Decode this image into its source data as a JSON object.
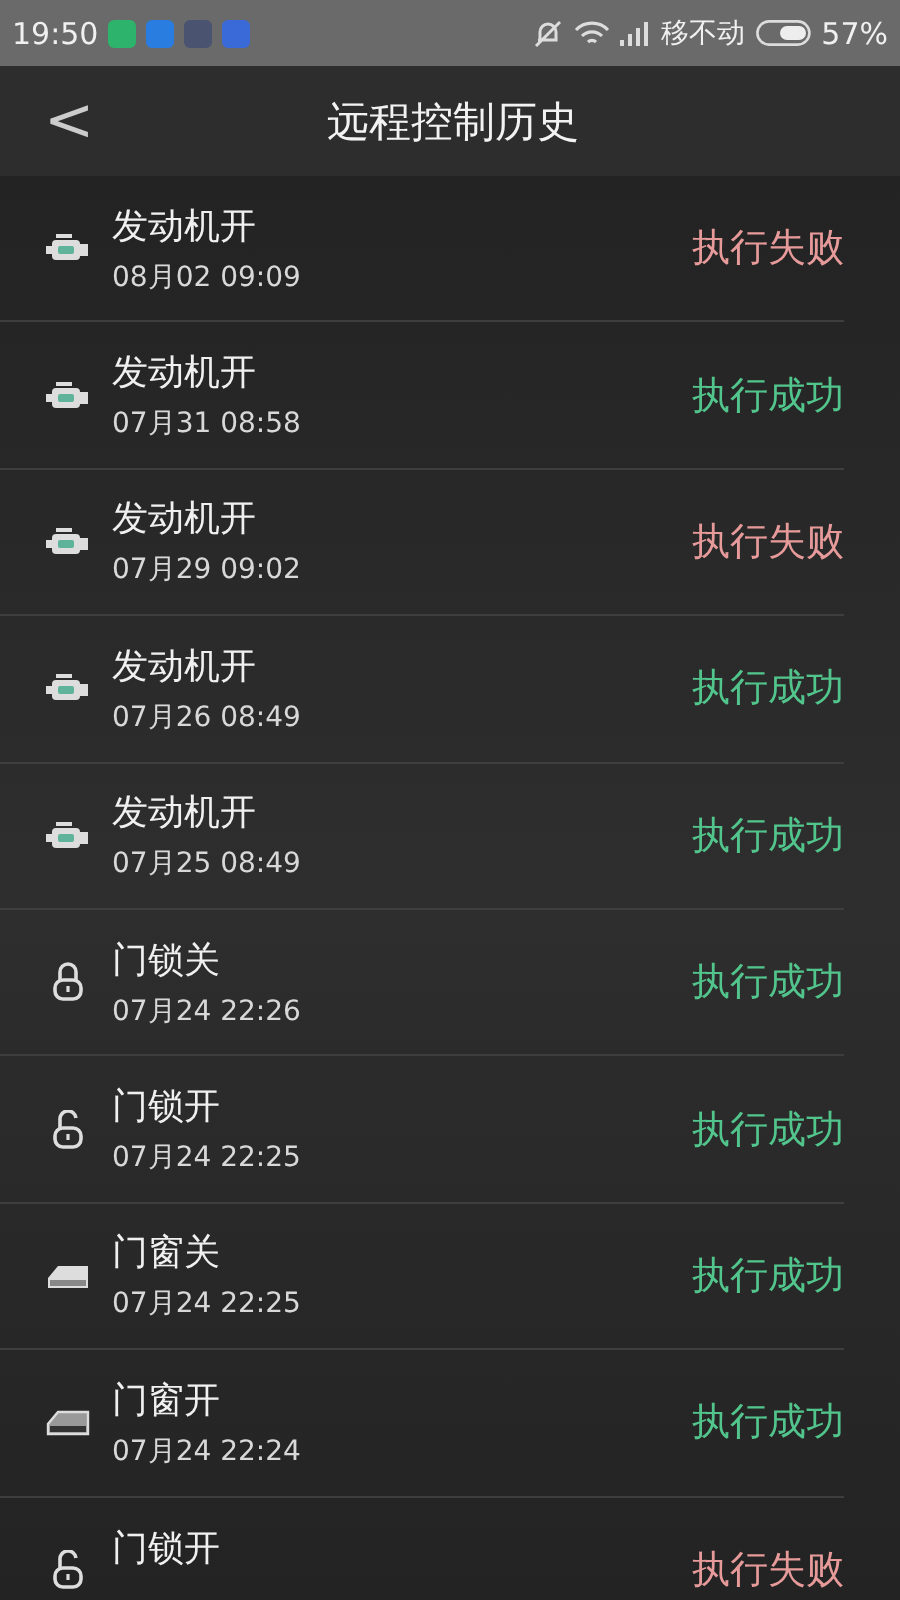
{
  "status_bar": {
    "time": "19:50",
    "carrier": "移不动",
    "battery": "57%"
  },
  "header": {
    "back": "<",
    "title": "远程控制历史"
  },
  "records": [
    {
      "kind": "engine",
      "title": "发动机开",
      "time": "08月02 09:09",
      "result": "执行失败",
      "success": false
    },
    {
      "kind": "engine",
      "title": "发动机开",
      "time": "07月31 08:58",
      "result": "执行成功",
      "success": true
    },
    {
      "kind": "engine",
      "title": "发动机开",
      "time": "07月29 09:02",
      "result": "执行失败",
      "success": false
    },
    {
      "kind": "engine",
      "title": "发动机开",
      "time": "07月26 08:49",
      "result": "执行成功",
      "success": true
    },
    {
      "kind": "engine",
      "title": "发动机开",
      "time": "07月25 08:49",
      "result": "执行成功",
      "success": true
    },
    {
      "kind": "lock_closed",
      "title": "门锁关",
      "time": "07月24 22:26",
      "result": "执行成功",
      "success": true
    },
    {
      "kind": "lock_open",
      "title": "门锁开",
      "time": "07月24 22:25",
      "result": "执行成功",
      "success": true
    },
    {
      "kind": "window_closed",
      "title": "门窗关",
      "time": "07月24 22:25",
      "result": "执行成功",
      "success": true
    },
    {
      "kind": "window_open",
      "title": "门窗开",
      "time": "07月24 22:24",
      "result": "执行成功",
      "success": true
    },
    {
      "kind": "lock_open",
      "title": "门锁开",
      "result": "执行失败",
      "success": false
    }
  ]
}
